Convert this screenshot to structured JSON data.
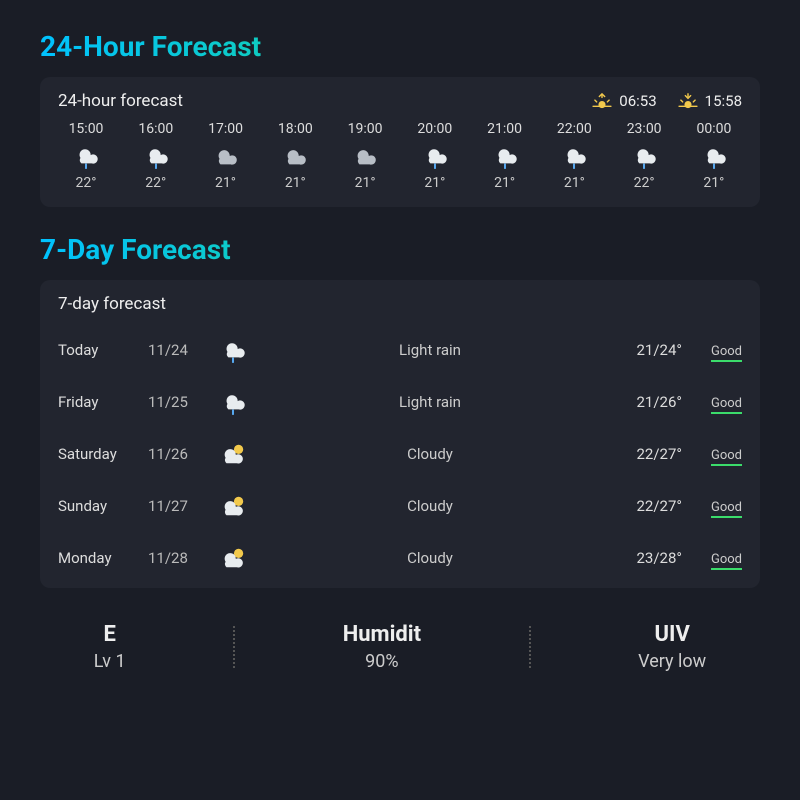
{
  "sections": {
    "hourly_title": "24-Hour Forecast",
    "daily_title": "7-Day Forecast"
  },
  "hourly_card": {
    "header": "24-hour forecast",
    "sunrise": "06:53",
    "sunset": "15:58",
    "items": [
      {
        "time": "15:00",
        "icon": "rain",
        "temp": "22°"
      },
      {
        "time": "16:00",
        "icon": "rain",
        "temp": "22°"
      },
      {
        "time": "17:00",
        "icon": "cloud",
        "temp": "21°"
      },
      {
        "time": "18:00",
        "icon": "cloud",
        "temp": "21°"
      },
      {
        "time": "19:00",
        "icon": "cloud",
        "temp": "21°"
      },
      {
        "time": "20:00",
        "icon": "rain",
        "temp": "21°"
      },
      {
        "time": "21:00",
        "icon": "rain",
        "temp": "21°"
      },
      {
        "time": "22:00",
        "icon": "rain",
        "temp": "21°"
      },
      {
        "time": "23:00",
        "icon": "rain",
        "temp": "22°"
      },
      {
        "time": "00:00",
        "icon": "rain",
        "temp": "21°"
      }
    ]
  },
  "daily_card": {
    "header": "7-day forecast",
    "items": [
      {
        "name": "Today",
        "date": "11/24",
        "icon": "rain",
        "cond": "Light rain",
        "temps": "21/24°",
        "air": "Good"
      },
      {
        "name": "Friday",
        "date": "11/25",
        "icon": "rain",
        "cond": "Light rain",
        "temps": "21/26°",
        "air": "Good"
      },
      {
        "name": "Saturday",
        "date": "11/26",
        "icon": "cloud-sun",
        "cond": "Cloudy",
        "temps": "22/27°",
        "air": "Good"
      },
      {
        "name": "Sunday",
        "date": "11/27",
        "icon": "cloud-sun",
        "cond": "Cloudy",
        "temps": "22/27°",
        "air": "Good"
      },
      {
        "name": "Monday",
        "date": "11/28",
        "icon": "cloud-sun",
        "cond": "Cloudy",
        "temps": "23/28°",
        "air": "Good"
      }
    ]
  },
  "bottom": {
    "wind_label": "E",
    "wind_value": "Lv 1",
    "humidity_label": "Humidit",
    "humidity_value": "90%",
    "uv_label": "UIV",
    "uv_value": "Very low"
  }
}
